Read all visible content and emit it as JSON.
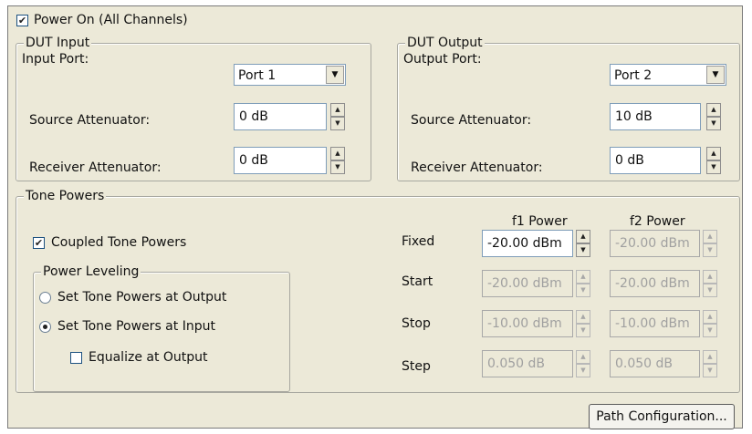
{
  "power_on": {
    "label": "Power On (All Channels)",
    "checked": true
  },
  "dut_input": {
    "title": "DUT Input",
    "port_label": "Input Port:",
    "port_value": "Port 1",
    "source_att_label": "Source Attenuator:",
    "source_att_value": "0 dB",
    "receiver_att_label": "Receiver Attenuator:",
    "receiver_att_value": "0 dB"
  },
  "dut_output": {
    "title": "DUT Output",
    "port_label": "Output Port:",
    "port_value": "Port 2",
    "source_att_label": "Source Attenuator:",
    "source_att_value": "10 dB",
    "receiver_att_label": "Receiver Attenuator:",
    "receiver_att_value": "0 dB"
  },
  "tone_powers": {
    "title": "Tone Powers",
    "coupled_label": "Coupled Tone Powers",
    "coupled_checked": true,
    "leveling": {
      "title": "Power Leveling",
      "option_output": "Set Tone Powers at Output",
      "option_input": "Set Tone Powers at Input",
      "selected": "input",
      "equalize_label": "Equalize at Output",
      "equalize_checked": false
    },
    "col_f1": "f1 Power",
    "col_f2": "f2 Power",
    "rows": [
      {
        "label": "Fixed",
        "f1": "-20.00 dBm",
        "f2": "-20.00 dBm"
      },
      {
        "label": "Start",
        "f1": "-20.00 dBm",
        "f2": "-20.00 dBm"
      },
      {
        "label": "Stop",
        "f1": "-10.00 dBm",
        "f2": "-10.00 dBm"
      },
      {
        "label": "Step",
        "f1": "0.050 dB",
        "f2": "0.050 dB"
      }
    ]
  },
  "path_config_label": "Path Configuration...",
  "icons": {
    "check": "✔",
    "dropdown": "▼",
    "spin_up": "▲",
    "spin_down": "▼"
  }
}
